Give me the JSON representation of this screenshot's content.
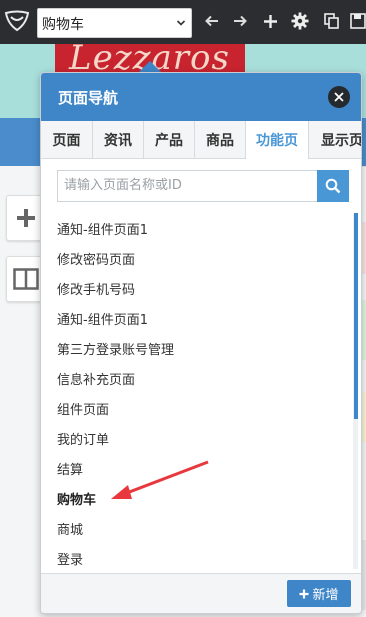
{
  "toolbar": {
    "page_select_value": "购物车",
    "icons": [
      "logo-icon",
      "chevron-down-icon",
      "arrow-left-icon",
      "arrow-right-icon",
      "plus-icon",
      "gear-icon",
      "copy-icon",
      "save-icon"
    ]
  },
  "background": {
    "logo_text": "Lezzaros",
    "side_buttons": [
      "plus-icon",
      "layout-icon"
    ]
  },
  "popup": {
    "title": "页面导航",
    "tabs": [
      "页面",
      "资讯",
      "产品",
      "商品",
      "功能页",
      "显示页"
    ],
    "active_tab": "功能页",
    "search_placeholder": "请输入页面名称或ID",
    "items": [
      "通知-组件页面1",
      "修改密码页面",
      "修改手机号码",
      "通知-组件页面1",
      "第三方登录账号管理",
      "信息补充页面",
      "组件页面",
      "我的订单",
      "结算",
      "购物车",
      "商城",
      "登录"
    ],
    "selected_item": "购物车",
    "add_button_label": "新增"
  },
  "colors": {
    "toolbar_bg": "#2b2d30",
    "header_blue": "#3f86c9",
    "active_tab_text": "#4a97d6",
    "annotation_red": "#e8383d"
  }
}
